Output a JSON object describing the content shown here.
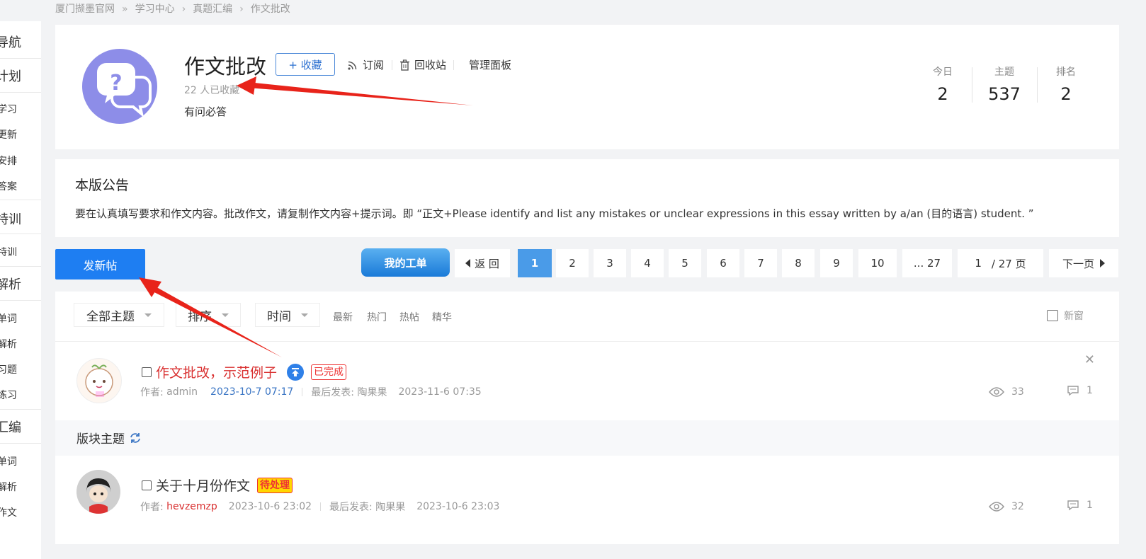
{
  "breadcrumb": {
    "items": [
      "厦门撷墨官网",
      "学习中心",
      "真题汇编",
      "作文批改"
    ],
    "separators": [
      "»",
      "›",
      "›"
    ]
  },
  "leftnav": {
    "items": [
      "导航",
      "计划",
      "学习",
      "更新",
      "安排",
      "答案",
      "特训",
      "特训",
      "解析",
      "单词",
      "解析",
      "习题",
      "练习",
      "汇编",
      "单词",
      "解析",
      "作文"
    ]
  },
  "header": {
    "title": "作文批改",
    "favorite_button": "+ 收藏",
    "subscribe": "订阅",
    "recycle": "回收站",
    "admin_panel": "管理面板",
    "favorite_count": "22 人已收藏",
    "description": "有问必答",
    "icon": "question-chat-icon",
    "icon_color": "#8d8de8",
    "stats": [
      {
        "label": "今日",
        "value": "2"
      },
      {
        "label": "主题",
        "value": "537"
      },
      {
        "label": "排名",
        "value": "2"
      }
    ]
  },
  "announcement": {
    "title": "本版公告",
    "body": "要在认真填写要求和作文内容。批改作文，请复制作文内容+提示词。即 “正文+Please identify and list any mistakes or unclear expressions in this essay written by a/an (目的语言) student. ”"
  },
  "toolbar": {
    "new_post": "发新帖",
    "my_tickets": "我的工单",
    "back": "返 回",
    "pages": [
      "1",
      "2",
      "3",
      "4",
      "5",
      "6",
      "7",
      "8",
      "9",
      "10"
    ],
    "current_page": "1",
    "last_page": "... 27",
    "page_input_value": "1",
    "page_total": "/ 27 页",
    "next": "下一页",
    "accent_color": "#1e7ef2"
  },
  "filters": {
    "dropdowns": [
      "全部主题",
      "排序",
      "时间"
    ],
    "links": [
      "最新",
      "热门",
      "热帖",
      "精华"
    ],
    "new_window": "新窗"
  },
  "sticky_thread": {
    "title": "作文批改，示范例子",
    "tag": "已完成",
    "author_label": "作者:",
    "author": "admin",
    "created": "2023-10-7 07:17",
    "last_post_label": "最后发表:",
    "last_poster": "陶果果",
    "last_post_time": "2023-11-6 07:35",
    "views": "33",
    "replies": "1",
    "title_color": "#d93030"
  },
  "section": {
    "label": "版块主题"
  },
  "threads": [
    {
      "title": "关于十月份作文",
      "tag": "待处理",
      "author_label": "作者:",
      "author": "hevzemzp",
      "created": "2023-10-6 23:02",
      "last_post_label": "最后发表:",
      "last_poster": "陶果果",
      "last_post_time": "2023-10-6 23:03",
      "views": "32",
      "replies": "1"
    }
  ]
}
